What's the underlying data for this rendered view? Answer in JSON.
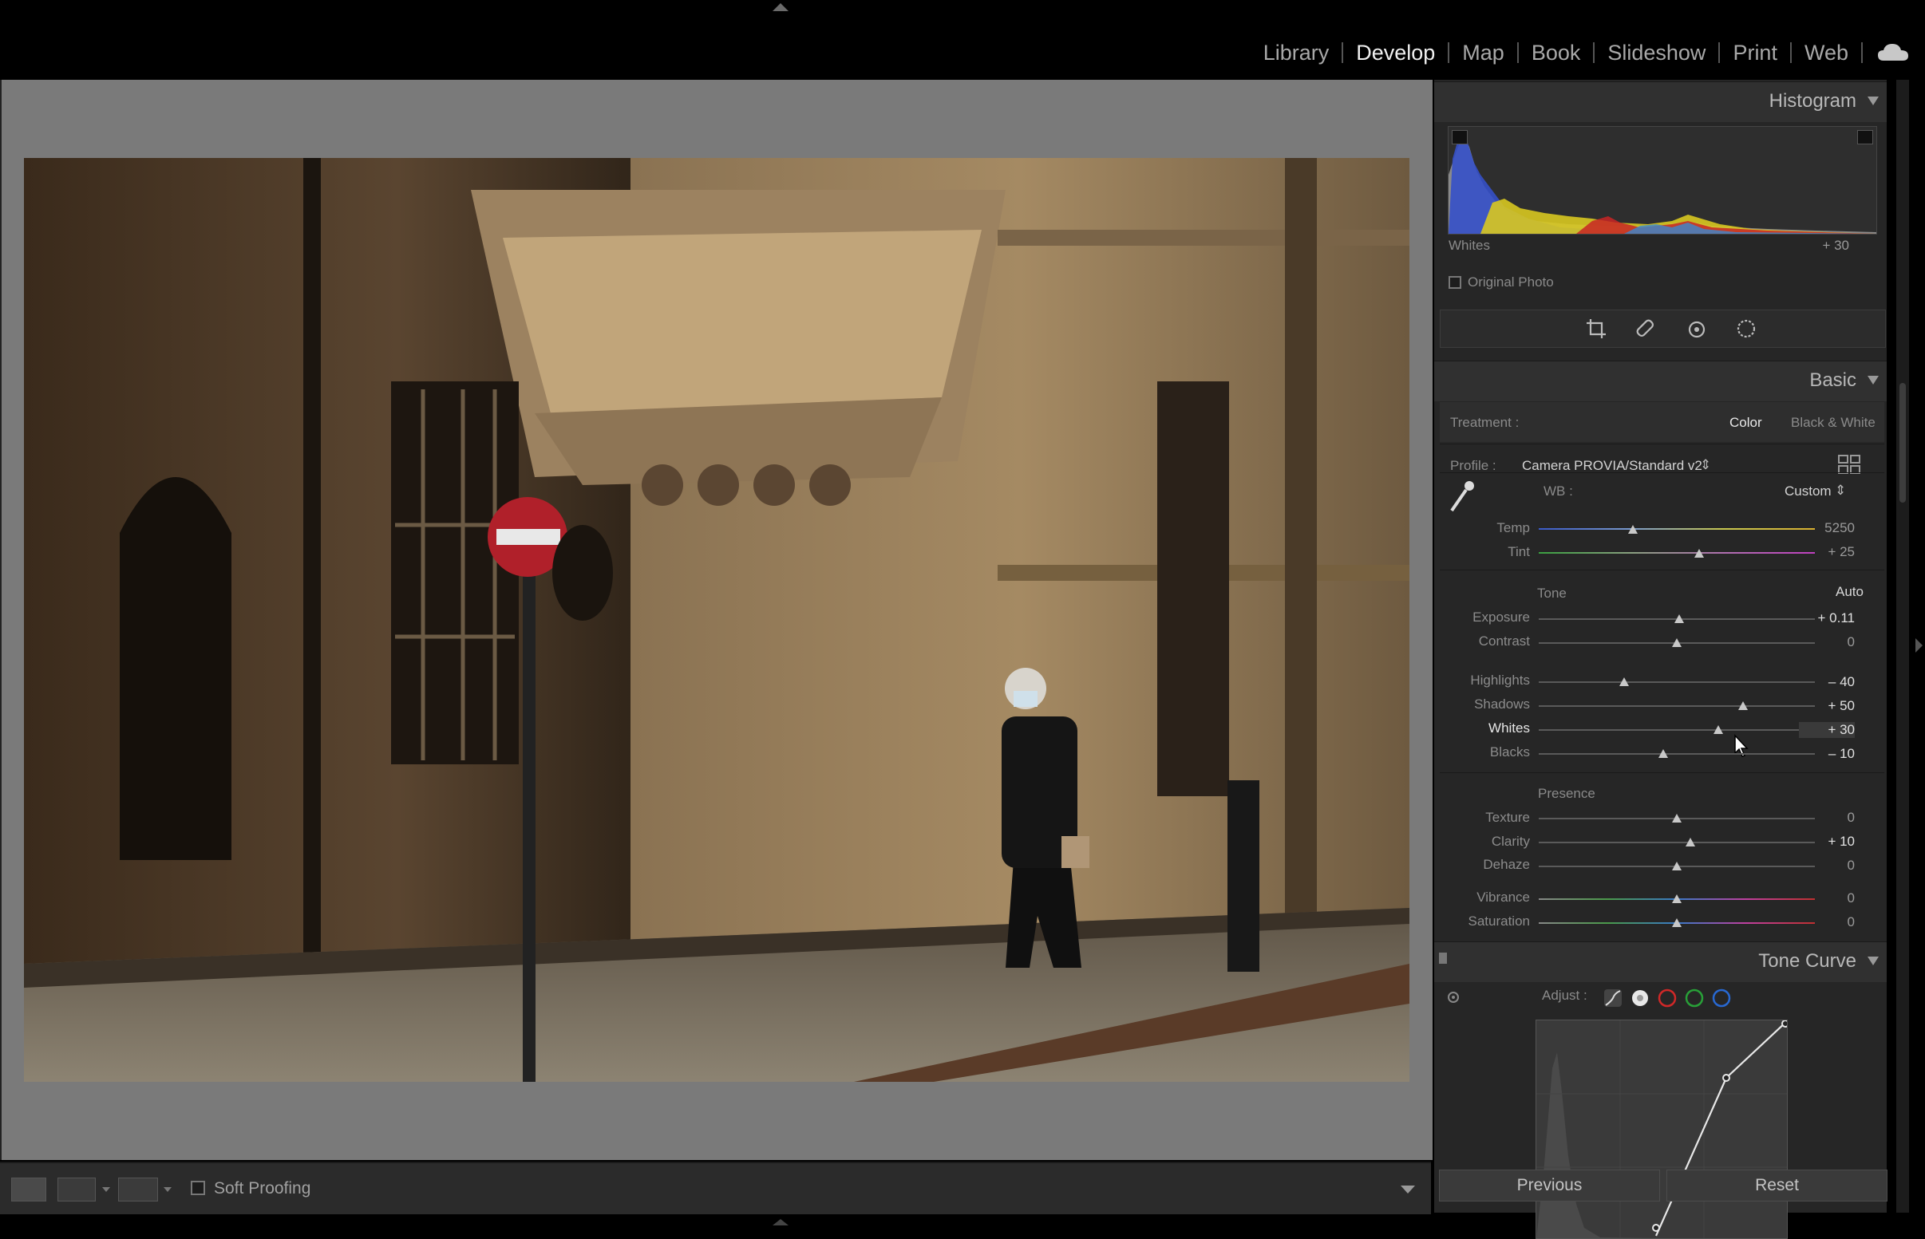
{
  "modules": [
    "Library",
    "Develop",
    "Map",
    "Book",
    "Slideshow",
    "Print",
    "Web"
  ],
  "active_module": "Develop",
  "toolbar": {
    "soft_proofing": "Soft Proofing"
  },
  "histogram": {
    "title": "Histogram",
    "readout_label": "Whites",
    "readout_value": "+ 30",
    "original_photo": "Original Photo"
  },
  "basic": {
    "title": "Basic",
    "treatment_label": "Treatment :",
    "treatment_color": "Color",
    "treatment_bw": "Black & White",
    "profile_label": "Profile :",
    "profile_value": "Camera PROVIA/Standard v2",
    "wb_label": "WB :",
    "wb_value": "Custom",
    "temp": {
      "label": "Temp",
      "value": "5250",
      "position": 0.34
    },
    "tint": {
      "label": "Tint",
      "value": "+ 25",
      "position": 0.58
    },
    "tone_label": "Tone",
    "auto_label": "Auto",
    "exposure": {
      "label": "Exposure",
      "value": "+ 0.11",
      "position": 0.51
    },
    "contrast": {
      "label": "Contrast",
      "value": "0",
      "position": 0.5
    },
    "highlights": {
      "label": "Highlights",
      "value": "– 40",
      "position": 0.31
    },
    "shadows": {
      "label": "Shadows",
      "value": "+ 50",
      "position": 0.74
    },
    "whites": {
      "label": "Whites",
      "value": "+ 30",
      "position": 0.65
    },
    "blacks": {
      "label": "Blacks",
      "value": "– 10",
      "position": 0.45
    },
    "presence_label": "Presence",
    "texture": {
      "label": "Texture",
      "value": "0",
      "position": 0.5
    },
    "clarity": {
      "label": "Clarity",
      "value": "+ 10",
      "position": 0.55
    },
    "dehaze": {
      "label": "Dehaze",
      "value": "0",
      "position": 0.5
    },
    "vibrance": {
      "label": "Vibrance",
      "value": "0",
      "position": 0.5
    },
    "saturation": {
      "label": "Saturation",
      "value": "0",
      "position": 0.5
    }
  },
  "tone_curve": {
    "title": "Tone Curve",
    "adjust_label": "Adjust :"
  },
  "buttons": {
    "previous": "Previous",
    "reset": "Reset"
  }
}
